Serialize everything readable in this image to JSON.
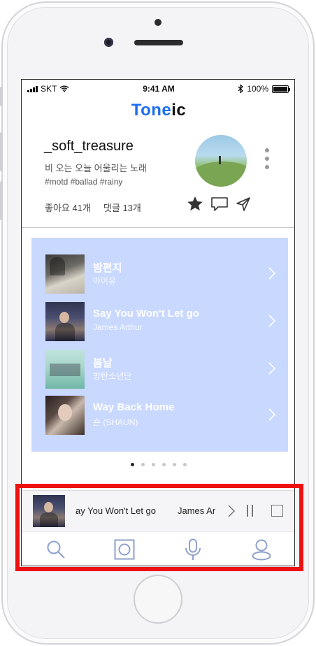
{
  "status_bar": {
    "carrier": "SKT",
    "time": "9:41 AM",
    "battery": "100%"
  },
  "brand": {
    "part1": "Tone",
    "part2": "ic"
  },
  "post": {
    "username": "_soft_treasure",
    "song_description": "비 오는 오늘 어울리는 노래",
    "tags": "#motd #ballad #rainy",
    "likes": "좋아요 41개",
    "comments": "댓글 13개"
  },
  "playlist": {
    "items": [
      {
        "title": "밤편지",
        "artist": "아이유"
      },
      {
        "title": "Say You Won't Let go",
        "artist": "James Arthur"
      },
      {
        "title": "봄날",
        "artist": "방탄소년단"
      },
      {
        "title": "Way Back Home",
        "artist": "숀 (SHAUN)"
      }
    ]
  },
  "pagination": {
    "total": 6,
    "active": 1
  },
  "now_playing": {
    "title": "ay You Won't Let go",
    "artist": "James Ar"
  },
  "tabbar": {
    "items": [
      "search",
      "library",
      "microphone",
      "profile"
    ]
  },
  "colors": {
    "accent": "#1b6ef0",
    "playlist_bg": "#c9d8ff",
    "highlight": "#ee1111",
    "icon": "#8ea0cc"
  },
  "icons": {
    "actions": [
      "star-icon",
      "comment-icon",
      "send-icon"
    ],
    "tabs": [
      "search-icon",
      "library-icon",
      "microphone-icon",
      "profile-icon"
    ]
  }
}
